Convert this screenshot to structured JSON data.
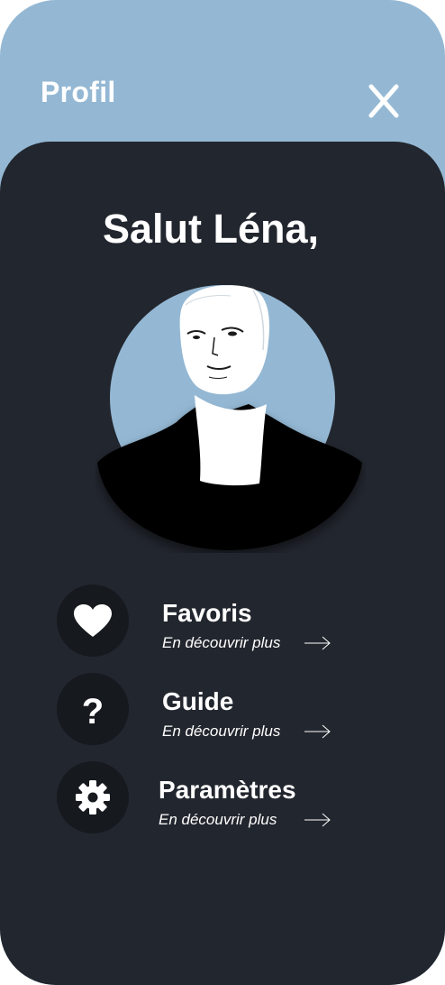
{
  "header": {
    "title": "Profil",
    "close_icon": "close-icon"
  },
  "greeting": "Salut Léna,",
  "avatar": {
    "icon": "user-portrait-illustration"
  },
  "menu": [
    {
      "label": "Favoris",
      "sub": "En découvrir plus",
      "icon": "heart-icon"
    },
    {
      "label": "Guide",
      "sub": "En découvrir plus",
      "icon": "question-icon"
    },
    {
      "label": "Paramètres",
      "sub": "En découvrir plus",
      "icon": "gear-icon"
    }
  ],
  "colors": {
    "header_bg": "#94b8d4",
    "panel_bg": "#22262e",
    "icon_bg": "#16191e",
    "text": "#ffffff"
  }
}
